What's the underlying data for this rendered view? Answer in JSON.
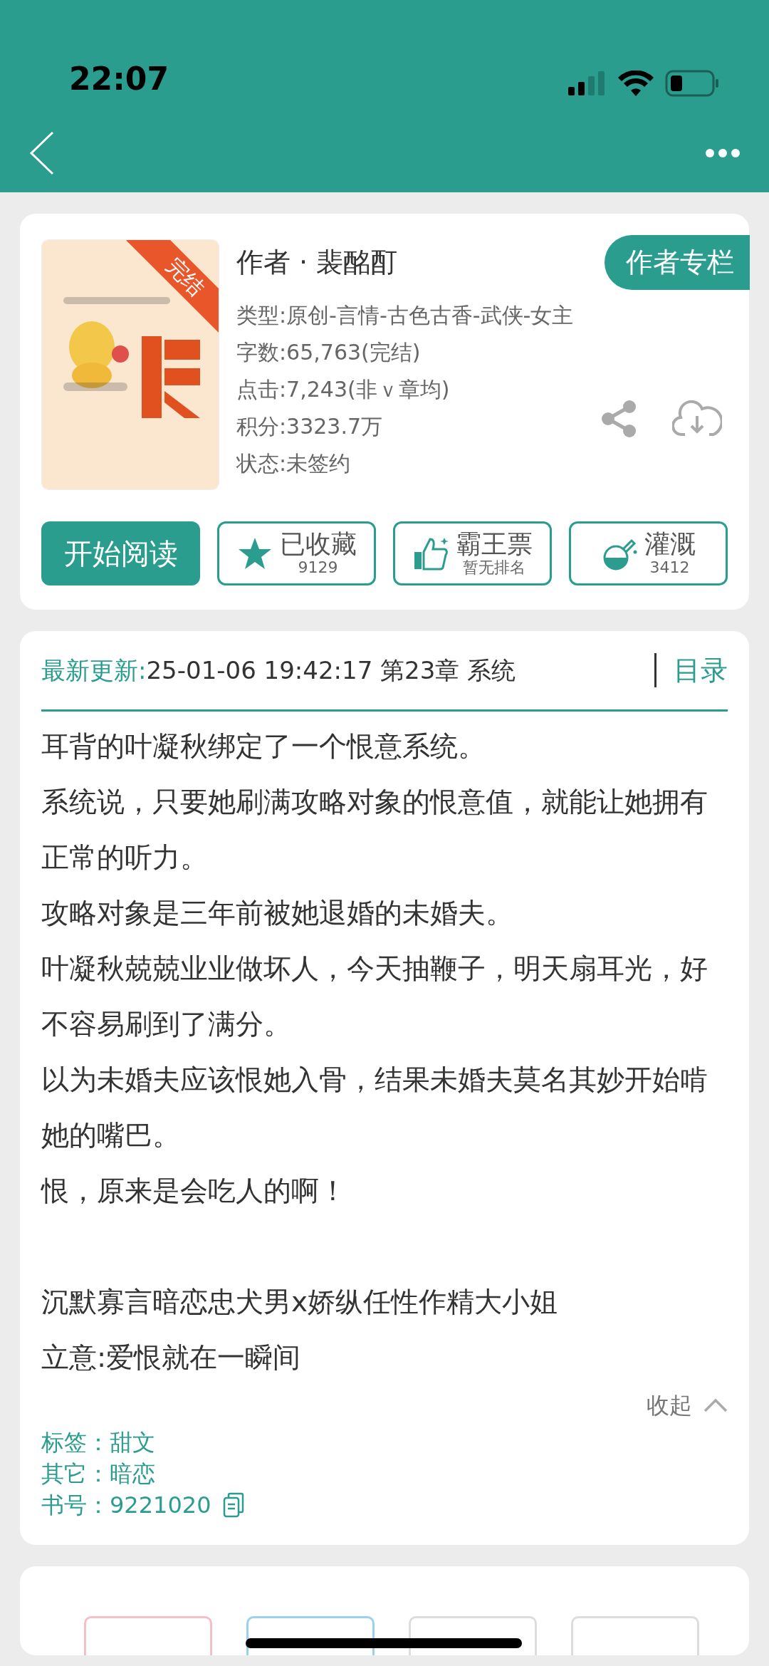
{
  "status_bar": {
    "time": "22:07"
  },
  "book": {
    "status_ribbon": "完结",
    "author": "作者 · 裴酩酊",
    "author_column_button": "作者专栏",
    "info": [
      "类型:原创-言情-古色古香-武侠-女主",
      "字数:65,763(完结)",
      "点击:7,243(非ｖ章均)",
      "积分:3323.7万",
      "状态:未签约"
    ]
  },
  "actions": [
    {
      "kind": "primary",
      "label": "开始阅读"
    },
    {
      "kind": "favorite",
      "label": "已收藏",
      "sub": "9129"
    },
    {
      "kind": "vote",
      "label": "霸王票",
      "sub": "暂无排名"
    },
    {
      "kind": "water",
      "label": "灌溉",
      "sub": "3412"
    }
  ],
  "update": {
    "label": "最新更新:",
    "text": "25-01-06 19:42:17   第23章 系统",
    "catalog": "目录"
  },
  "synopsis": [
    "耳背的叶凝秋绑定了一个恨意系统。",
    "系统说，只要她刷满攻略对象的恨意值，就能让她拥有正常的听力。",
    "攻略对象是三年前被她退婚的未婚夫。",
    "叶凝秋兢兢业业做坏人，今天抽鞭子，明天扇耳光，好不容易刷到了满分。",
    "以为未婚夫应该恨她入骨，结果未婚夫莫名其妙开始啃她的嘴巴。",
    "恨，原来是会吃人的啊！"
  ],
  "tagline": [
    "沉默寡言暗恋忠犬男x娇纵任性作精大小姐",
    "立意:爱恨就在一瞬间"
  ],
  "collapse": "收起",
  "meta": [
    {
      "kind": "text",
      "label": "标签：",
      "value": "甜文"
    },
    {
      "kind": "text",
      "label": "其它：",
      "value": "暗恋"
    },
    {
      "kind": "copyable",
      "label": "书号：",
      "value": "9221020"
    }
  ]
}
